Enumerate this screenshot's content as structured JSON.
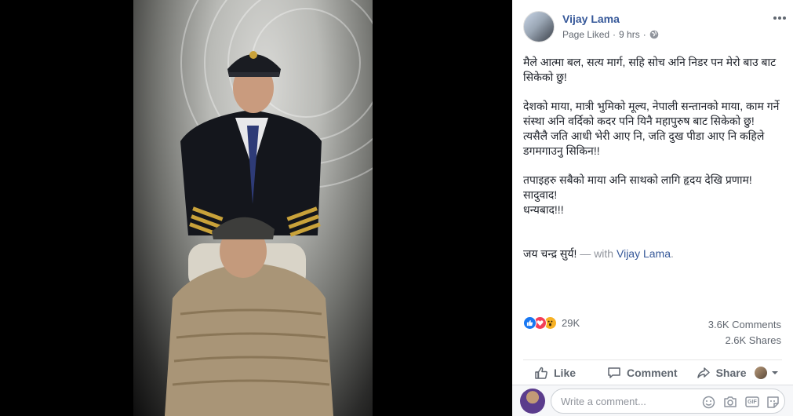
{
  "post": {
    "author": "Vijay Lama",
    "meta_page": "Page Liked",
    "meta_sep": "·",
    "meta_time": "9 hrs",
    "meta_sep2": "·",
    "para1": "मैले आत्मा बल, सत्य मार्ग, सहि सोच अनि निडर पन मेरो बाउ बाट सिकेको छु!",
    "para2_line1": "देशको माया, मात्री भुमिको मूल्य, नेपाली सन्तानको माया, काम गर्ने संस्था अनि वर्दिको कदर पनि यिनै महापुरुष बाट सिकेको छु!",
    "para2_line2": "त्यसैलै जति आधी भेरी आए नि, जति दुख पीडा आए नि कहिले डगमगाउनु सिकिन!!",
    "para3": "तपाइहरु सबैको माया अनि साथको लागि हृदय देखि प्रणाम!\nसादुवाद!\nधन्यबाद!!!",
    "sign_text": "जय चन्द्र सुर्य!",
    "with_text": " — with ",
    "with_name": "Vijay Lama",
    "with_end": "."
  },
  "stats": {
    "reactions_count": "29K",
    "comments": "3.6K Comments",
    "shares": "2.6K Shares",
    "reaction_colors": {
      "like": "#1877f2",
      "love": "#f33e58",
      "wow": "#f7b125"
    }
  },
  "actions": {
    "like": "Like",
    "comment": "Comment",
    "share": "Share"
  },
  "composer": {
    "placeholder": "Write a comment...",
    "gif_label": "GIF"
  },
  "icons": {
    "globe": "globe-icon",
    "more": "more-options-icon",
    "like": "thumbs-up-icon",
    "comment": "speech-bubble-icon",
    "share": "share-arrow-icon",
    "emoji": "emoji-icon",
    "camera": "camera-icon",
    "gif": "gif-icon",
    "sticker": "sticker-icon"
  }
}
